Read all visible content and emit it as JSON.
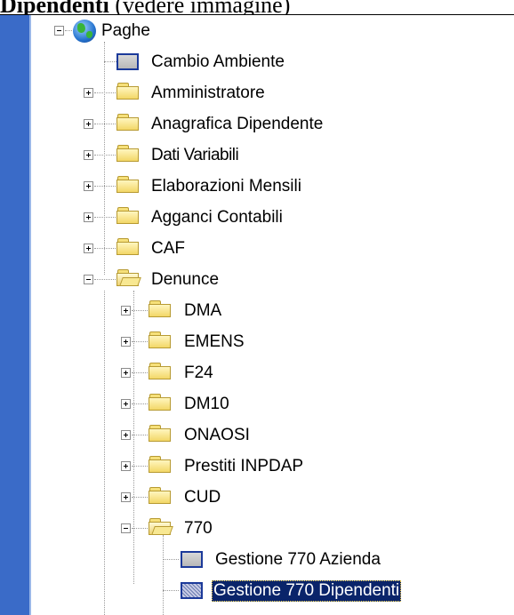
{
  "header": {
    "bold_text": "Dipendenti",
    "rest_text": " (vedere immagine)"
  },
  "tree": {
    "root": {
      "label": "Paghe",
      "icon": "globe-icon",
      "expanded": true
    },
    "items": [
      {
        "label": "Cambio Ambiente",
        "icon": "window-icon"
      },
      {
        "label": "Amministratore",
        "icon": "folder-icon",
        "expanded": false
      },
      {
        "label": "Anagrafica Dipendente",
        "icon": "folder-icon",
        "expanded": false
      },
      {
        "label": "Dati Variabili",
        "icon": "folder-icon",
        "expanded": false
      },
      {
        "label": "Elaborazioni Mensili",
        "icon": "folder-icon",
        "expanded": false
      },
      {
        "label": "Agganci Contabili",
        "icon": "folder-icon",
        "expanded": false
      },
      {
        "label": "CAF",
        "icon": "folder-icon",
        "expanded": false
      },
      {
        "label": "Denunce",
        "icon": "folder-open-icon",
        "expanded": true
      },
      {
        "label": "DMA",
        "icon": "folder-icon",
        "expanded": false
      },
      {
        "label": "EMENS",
        "icon": "folder-icon",
        "expanded": false
      },
      {
        "label": "F24",
        "icon": "folder-icon",
        "expanded": false
      },
      {
        "label": "DM10",
        "icon": "folder-icon",
        "expanded": false
      },
      {
        "label": "ONAOSI",
        "icon": "folder-icon",
        "expanded": false
      },
      {
        "label": "Prestiti INPDAP",
        "icon": "folder-icon",
        "expanded": false
      },
      {
        "label": "CUD",
        "icon": "folder-icon",
        "expanded": false
      },
      {
        "label": "770",
        "icon": "folder-open-icon",
        "expanded": true
      },
      {
        "label": "Gestione 770 Azienda",
        "icon": "window-icon"
      },
      {
        "label": "Gestione 770 Dipendenti",
        "icon": "window-icon",
        "selected": true
      }
    ]
  }
}
